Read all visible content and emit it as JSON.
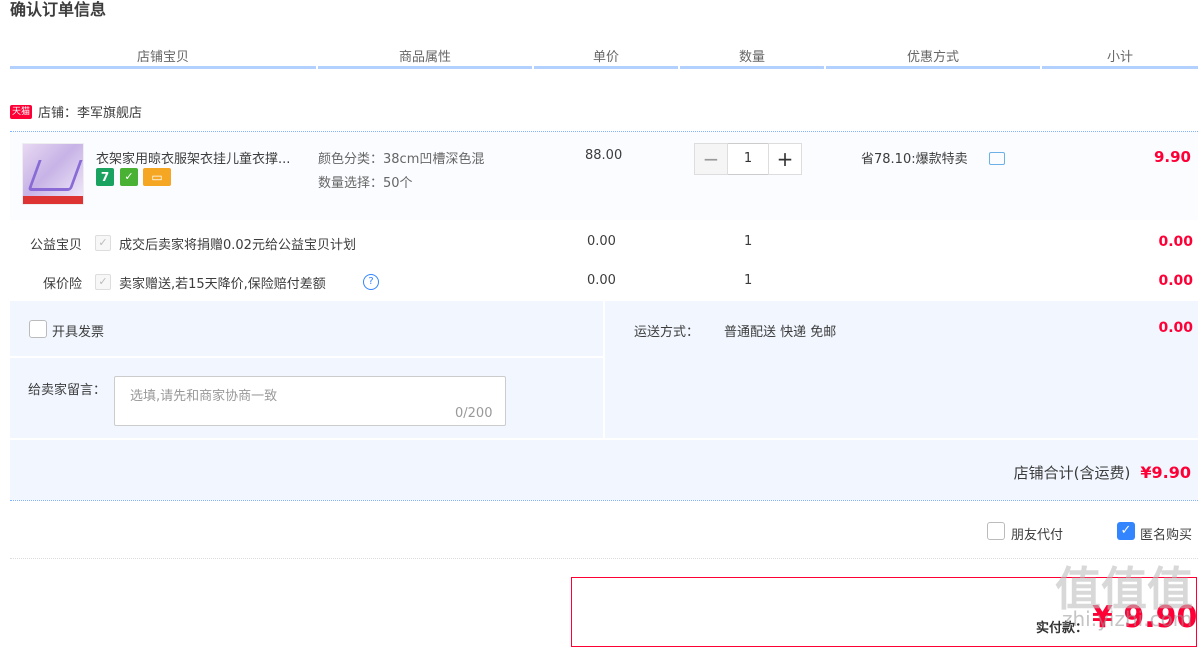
{
  "page_title": "确认订单信息",
  "columns": [
    "店铺宝贝",
    "商品属性",
    "单价",
    "数量",
    "优惠方式",
    "小计"
  ],
  "shop": {
    "badge": "天猫",
    "label": "店铺：李军旗舰店"
  },
  "item": {
    "name": "衣架家用晾衣服架衣挂儿童衣撑...",
    "badge_7": "7",
    "color_attr": "颜色分类：38cm凹槽深色混",
    "qty_attr": "数量选择：50个",
    "unit_price": "88.00",
    "quantity": "1",
    "promo": "省78.10:爆款特卖",
    "subtotal": "9.90"
  },
  "charity": {
    "label": "公益宝贝",
    "text": "成交后卖家将捐赠0.02元给公益宝贝计划",
    "price": "0.00",
    "qty": "1",
    "subtotal": "0.00"
  },
  "insurance": {
    "label": "保价险",
    "text": "卖家赠送,若15天降价,保险赔付差额",
    "price": "0.00",
    "qty": "1",
    "subtotal": "0.00",
    "help": "?"
  },
  "invoice": {
    "label": "开具发票"
  },
  "shipping": {
    "label": "运送方式：",
    "value": "普通配送 快递 免邮",
    "cost": "0.00"
  },
  "message": {
    "label": "给卖家留言：",
    "placeholder": "选填,请先和商家协商一致",
    "counter": "0/200"
  },
  "shop_total": {
    "label": "店铺合计(含运费)",
    "amount": "¥9.90"
  },
  "options": {
    "friend_pay": "朋友代付",
    "anonymous": "匿名购买",
    "anonymous_checked": true
  },
  "payment": {
    "label": "实付款：",
    "amount": "¥ 9.90"
  },
  "watermark": {
    "glyphs": "值值值",
    "site": "zhi.yizhi.com"
  },
  "colors": {
    "accent": "#ff0036",
    "blue": "#3385ff",
    "line": "#b2d1ff"
  }
}
